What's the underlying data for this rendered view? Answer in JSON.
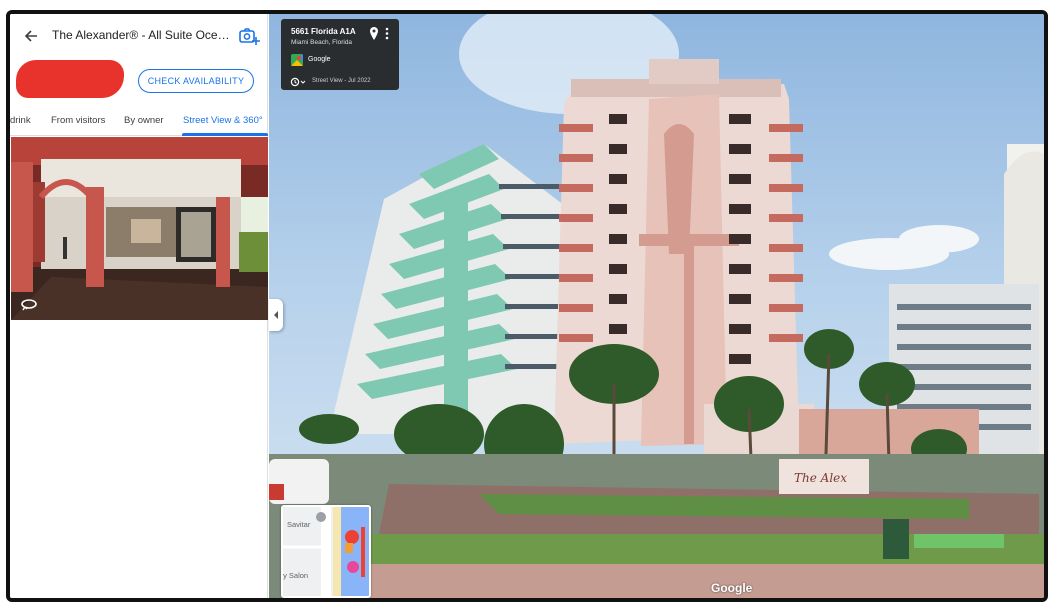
{
  "panel": {
    "title": "The Alexander® - All Suite Ocean...",
    "check_availability": "CHECK AVAILABILITY",
    "tabs": [
      {
        "label": "drink"
      },
      {
        "label": "From visitors"
      },
      {
        "label": "By owner"
      },
      {
        "label": "Street View & 360°",
        "active": true
      }
    ]
  },
  "street_view": {
    "info_card": {
      "address": "5661 Florida A1A",
      "city": "Miami Beach, Florida",
      "provider": "Google",
      "capture_date": "Street View - Jul 2022"
    },
    "minimap": {
      "label_top": "Savitar",
      "label_bottom": "ty Salon"
    },
    "watermark": "Google"
  },
  "colors": {
    "accent": "#1a73e8",
    "redaction": "#e8332d",
    "building_pink": "#e7c9c2",
    "building_teal": "#7fc8b2"
  },
  "icons": [
    "back-arrow-icon",
    "add-photo-icon",
    "rotate-360-icon",
    "location-pin-icon",
    "more-vert-icon",
    "google-maps-icon",
    "history-icon",
    "chevron-left-icon"
  ]
}
